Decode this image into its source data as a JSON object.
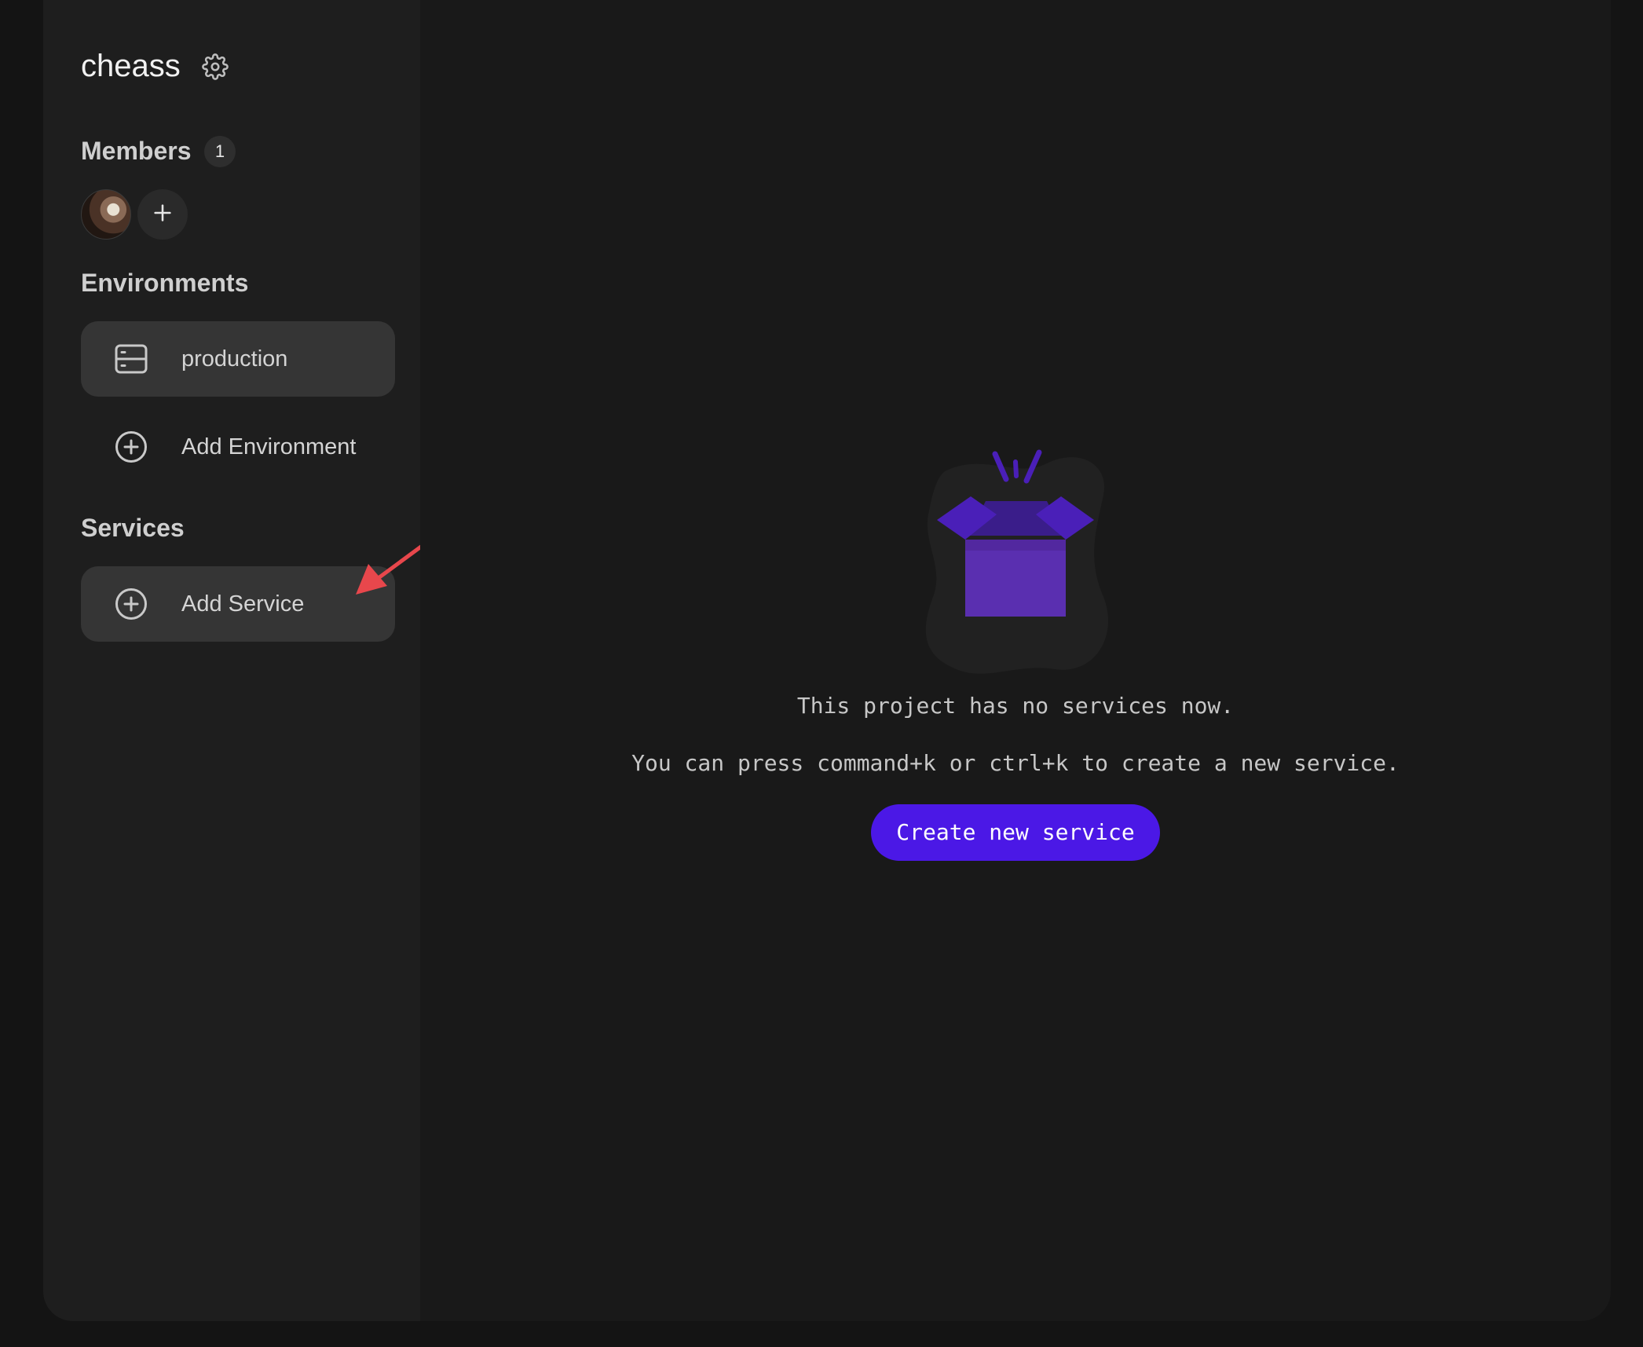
{
  "project": {
    "name": "cheass",
    "settings_icon": "gear-icon"
  },
  "members": {
    "title": "Members",
    "count": "1",
    "avatar_icon": "user-avatar",
    "add_icon": "plus-icon"
  },
  "environments": {
    "title": "Environments",
    "items": [
      {
        "label": "production",
        "icon": "server-icon",
        "active": true
      }
    ],
    "add_label": "Add Environment",
    "add_icon": "plus-circle-icon"
  },
  "services": {
    "title": "Services",
    "add_label": "Add Service",
    "add_icon": "plus-circle-icon"
  },
  "empty_state": {
    "illustration": "open-box-illustration",
    "message": "This project has no services now.",
    "hint": "You can press command+k or ctrl+k to create a new service.",
    "button_label": "Create new service"
  },
  "colors": {
    "accent": "#4b18e6",
    "box_front": "#5a2fb0",
    "box_lid": "#4a1fb8",
    "annotation_arrow": "#e8474c"
  }
}
